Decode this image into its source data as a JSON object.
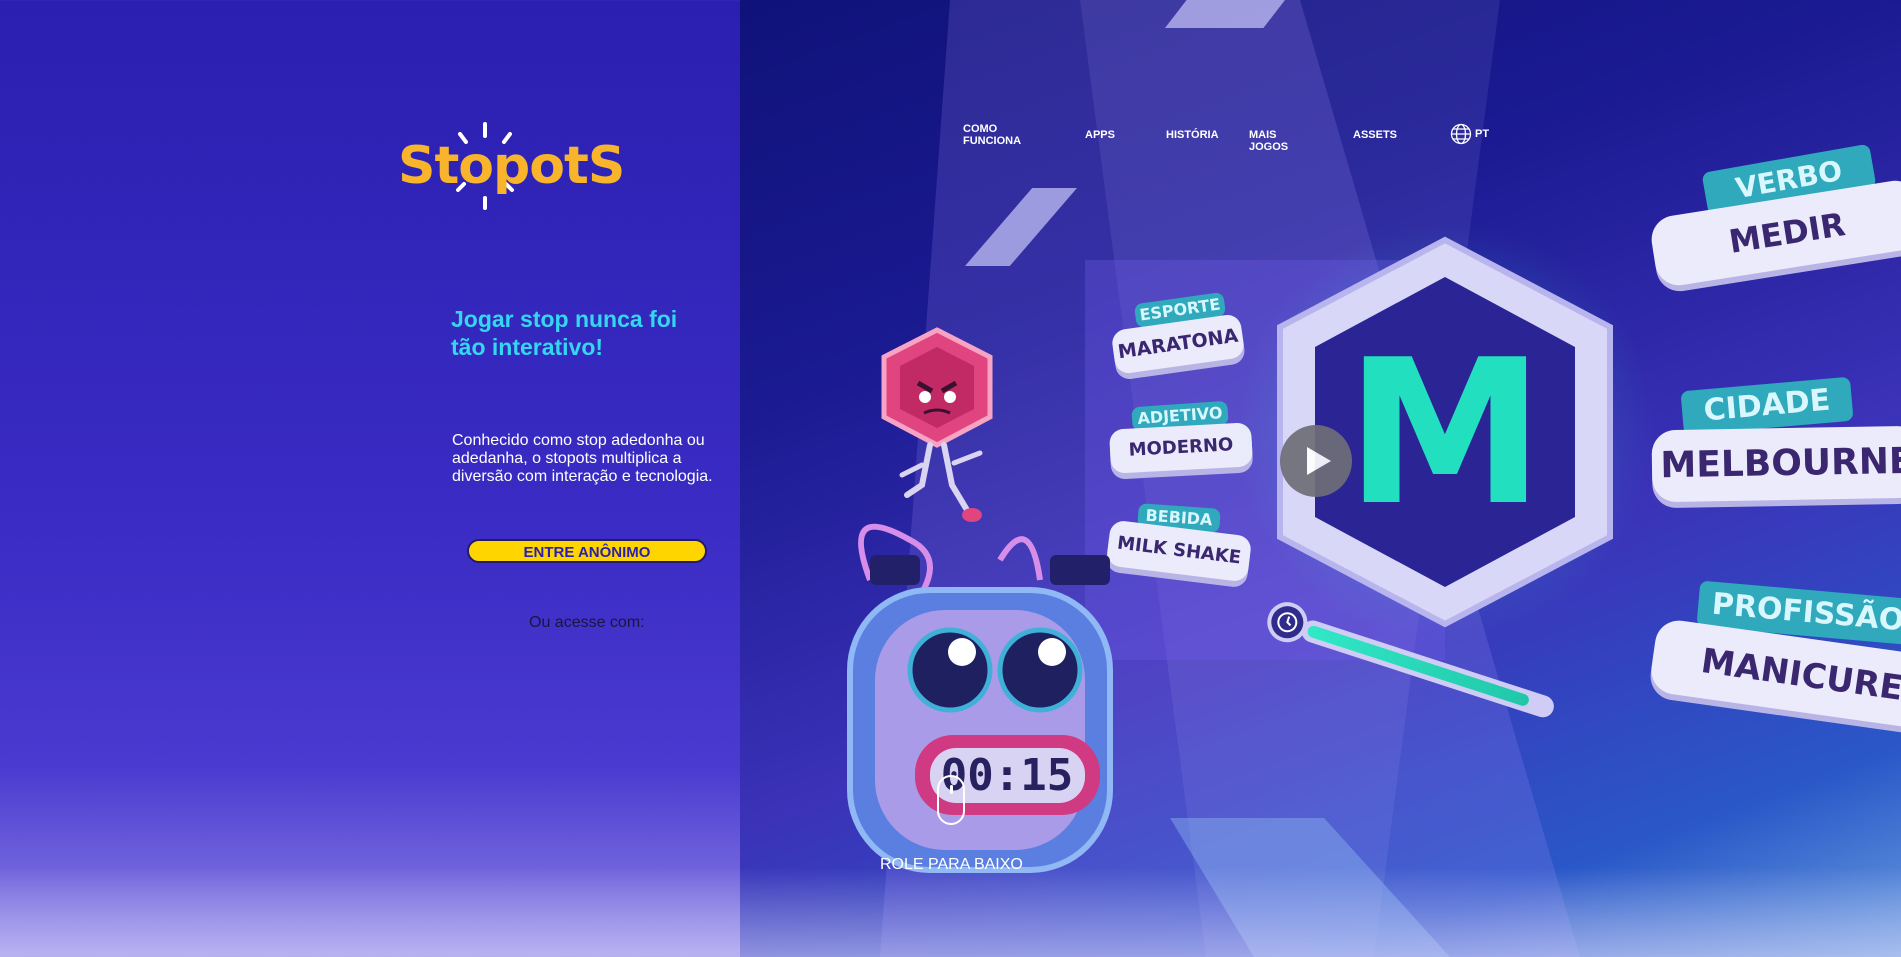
{
  "brand": {
    "logo_text": "StopotS",
    "logo_color": "#f8b52c"
  },
  "nav": {
    "items": [
      {
        "label": "COMO FUNCIONA"
      },
      {
        "label": "APPS"
      },
      {
        "label": "HISTÓRIA"
      },
      {
        "label": "MAIS JOGOS"
      },
      {
        "label": "ASSETS"
      }
    ],
    "language": "PT",
    "language_icon": "globe-icon"
  },
  "hero": {
    "headline": "Jogar stop nunca foi tão interativo!",
    "description": "Conhecido como stop adedonha ou adedanha, o stopots multiplica a diversão com interação e tecnologia.",
    "cta_label": "ENTRE ANÔNIMO",
    "or_access": "Ou acesse com:"
  },
  "illustration": {
    "letter": "M",
    "timer_display": "00:15",
    "timer_progress": 0.92,
    "cards_left": [
      {
        "category": "ESPORTE",
        "word": "MARATONA"
      },
      {
        "category": "ADJETIVO",
        "word": "MODERNO"
      },
      {
        "category": "BEBIDA",
        "word": "MILK SHAKE"
      }
    ],
    "cards_right": [
      {
        "category": "VERBO",
        "word": "MEDIR"
      },
      {
        "category": "CIDADE",
        "word": "MELBOURNE"
      },
      {
        "category": "PROFISSÃO",
        "word": "MANICURE"
      }
    ],
    "play_icon": "play-icon"
  },
  "scroll": {
    "label": "ROLE PARA BAIXO",
    "icon": "mouse-icon"
  },
  "colors": {
    "accent_cyan": "#35d7f0",
    "cta_yellow": "#ffd500",
    "teal": "#2fd9bf",
    "background_purple": "#2a1fb0"
  }
}
